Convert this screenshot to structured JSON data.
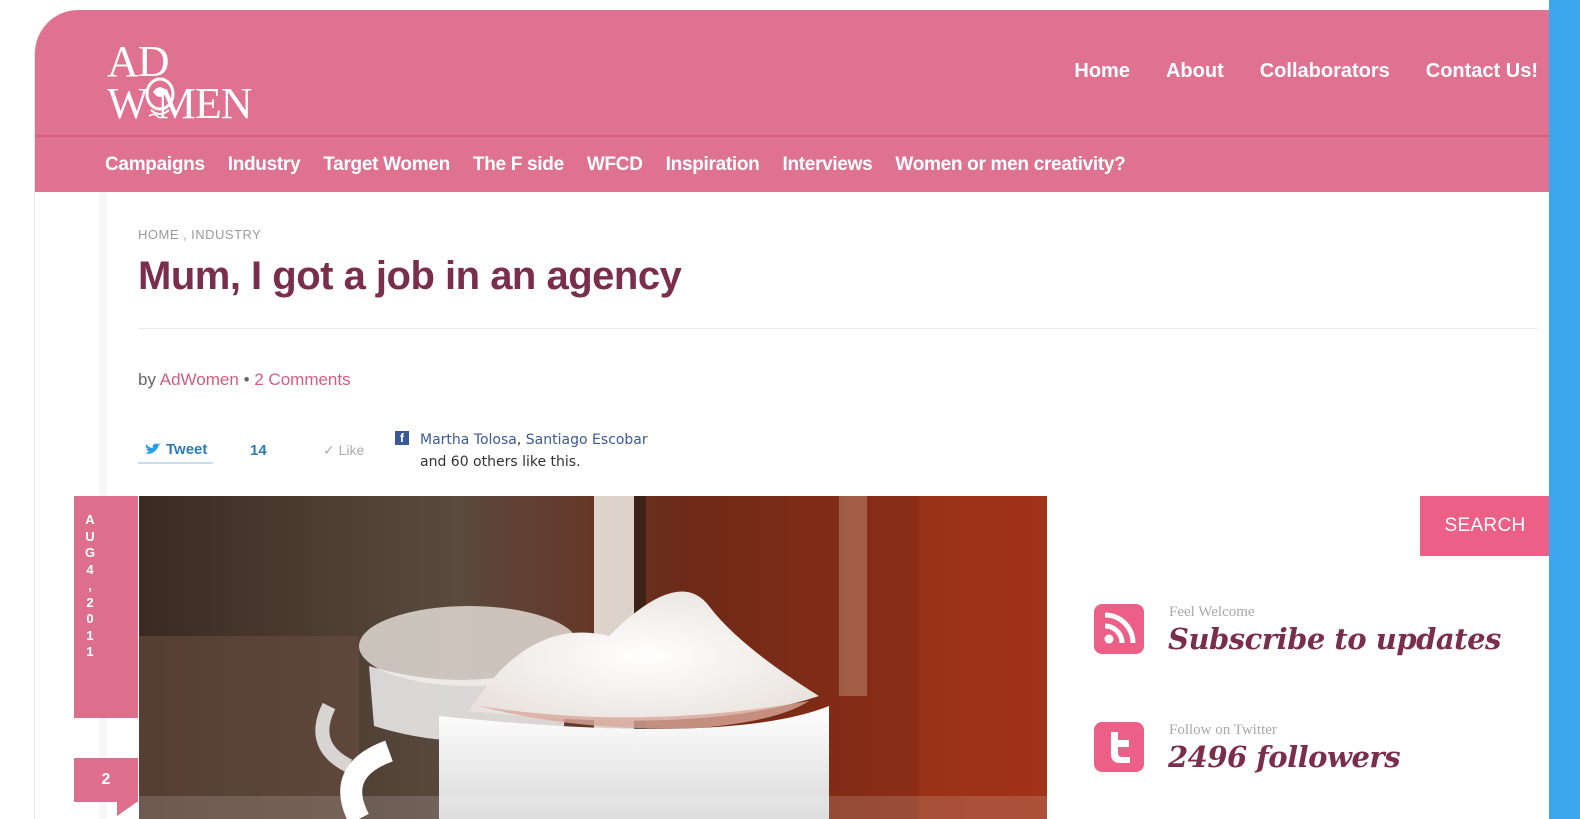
{
  "logo": {
    "line1": "AD",
    "line2": "W  MEN"
  },
  "top_nav": [
    "Home",
    "About",
    "Collaborators",
    "Contact Us!"
  ],
  "category_nav": [
    "Campaigns",
    "Industry",
    "Target Women",
    "The F side",
    "WFCD",
    "Inspiration",
    "Interviews",
    "Women or men creativity?"
  ],
  "breadcrumb": {
    "home": "HOME",
    "separator": ",",
    "section": "INDUSTRY"
  },
  "post": {
    "title": "Mum, I got a job in an agency",
    "by": "by",
    "author": "AdWomen",
    "dot": "•",
    "comments": "2 Comments"
  },
  "share": {
    "tweet_label": "Tweet",
    "tweet_count": "14",
    "like_label": "Like",
    "fb_icon": "f",
    "fb_friend_1": "Martha Tolosa",
    "fb_comma": ",",
    "fb_friend_2": "Santiago Escobar",
    "fb_others": "and 60 others like this."
  },
  "date_ribbon": {
    "letters": [
      "A",
      "U",
      "G",
      "4",
      ",",
      "2",
      "0",
      "1",
      "1"
    ],
    "comment_count": "2"
  },
  "sidebar": {
    "search_label": "SEARCH",
    "subscribe_small": "Feel Welcome",
    "subscribe_big": "Subscribe to updates",
    "twitter_small": "Follow on Twitter",
    "twitter_big": "2496 followers"
  },
  "icons": {
    "rss": "rss-icon",
    "twitter": "twitter-icon",
    "twitter_bird": "twitter-bird-icon",
    "facebook": "facebook-icon",
    "check": "check-icon"
  },
  "colors": {
    "header_pink": "#de7290",
    "accent_pink": "#ec5f86",
    "title_plum": "#7a2e4c",
    "link_pink": "#d35d82",
    "facebook_blue": "#3b5998"
  }
}
